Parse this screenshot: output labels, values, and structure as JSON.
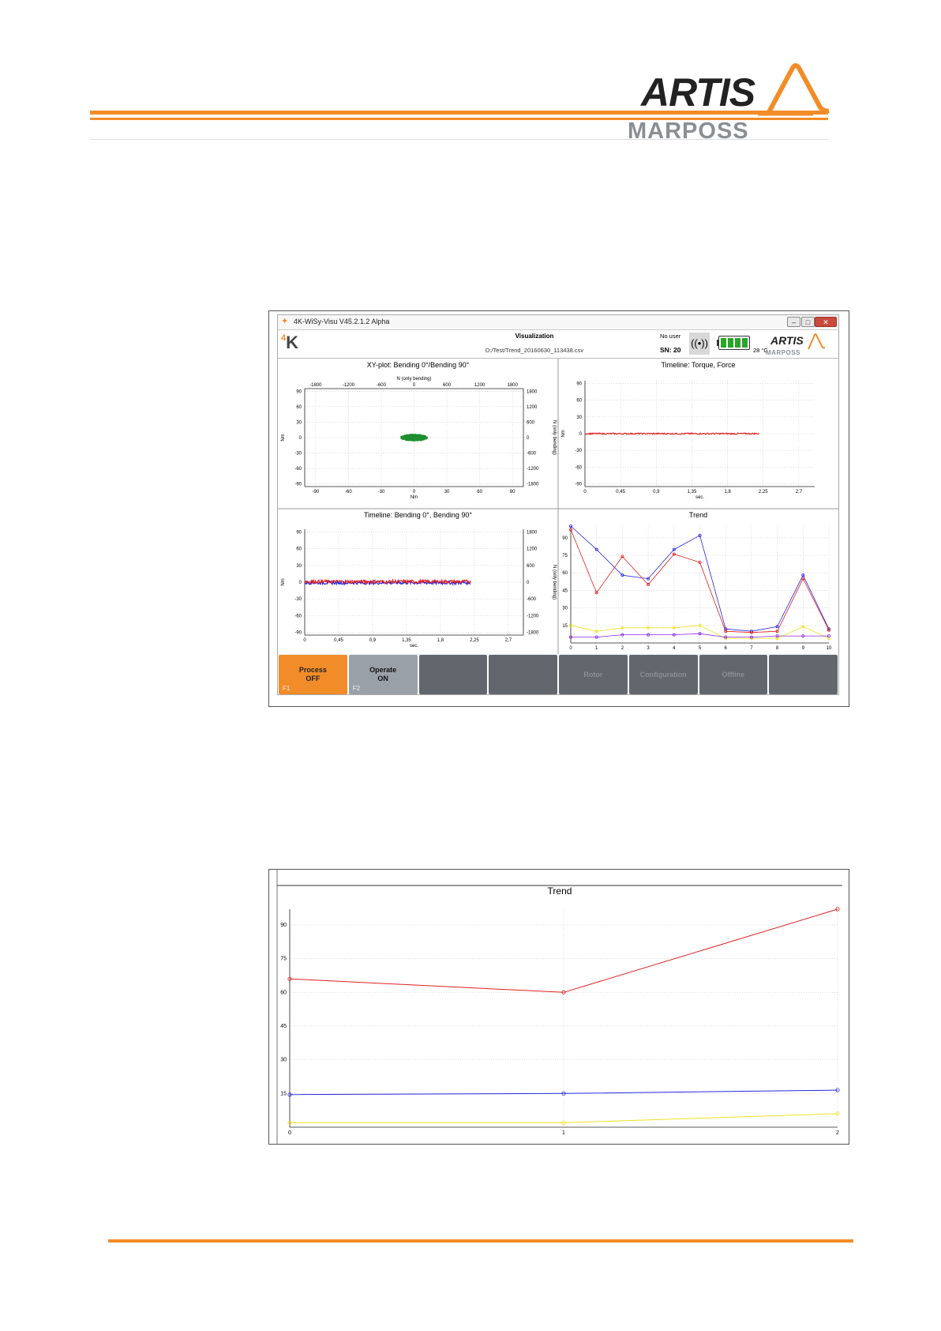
{
  "header": {
    "logo_brand": "ARTIS",
    "logo_sub": "MARPOSS"
  },
  "window": {
    "title": "4K-WiSy-Visu   V45.2.1.2 Alpha",
    "view_title": "Visualization",
    "file_path": "D:/Test/Trend_20160630_113438.csv",
    "user": "No user",
    "sn": "SN: 20",
    "temperature": "28 °C",
    "brand": "ARTIS",
    "brand_sub": "MARPOSS",
    "logo": "4K"
  },
  "function_keys": [
    {
      "label": "Process\nOFF",
      "key": "F1",
      "style": "orange"
    },
    {
      "label": "Operate\nON",
      "key": "F2",
      "style": "light"
    },
    {
      "label": "",
      "key": "",
      "style": "dark"
    },
    {
      "label": "",
      "key": "",
      "style": "dark"
    },
    {
      "label": "Rotor",
      "key": "",
      "style": "dim"
    },
    {
      "label": "Configuration",
      "key": "",
      "style": "dim"
    },
    {
      "label": "Offline",
      "key": "",
      "style": "dim"
    },
    {
      "label": "",
      "key": "",
      "style": "dark"
    }
  ],
  "colors": {
    "accent": "#f28c28",
    "red": "#e02020",
    "blue": "#2828e0",
    "yellow": "#f0e020",
    "purple": "#8a2be2",
    "green": "#1f8f2f"
  },
  "chart_data": [
    {
      "type": "scatter",
      "title": "XY-plot:  Bending 0°/Bending 90°",
      "xlabel": "Nm",
      "ylabel": "Nm",
      "x2label": "N (only bending)",
      "y2label": "N (only bending)",
      "xticks": [
        "-90",
        "-60",
        "-30",
        "0",
        "30",
        "60",
        "90"
      ],
      "x2ticks": [
        "-1800",
        "-1200",
        "-600",
        "0",
        "600",
        "1200",
        "1800"
      ],
      "yticks": [
        "90",
        "60",
        "30",
        "0",
        "-30",
        "-60",
        "-90"
      ],
      "y2ticks": [
        "1800",
        "1200",
        "600",
        "0",
        "-600",
        "-1200",
        "-1800"
      ],
      "xlim": [
        -100,
        100
      ],
      "ylim": [
        -95,
        95
      ],
      "cluster": {
        "center": [
          0,
          0
        ],
        "spread": [
          12,
          6
        ],
        "color": "#1f8f2f"
      }
    },
    {
      "type": "line",
      "title": "Timeline:  Torque, Force",
      "xlabel": "sec.",
      "ylabel": "Nm",
      "xticks": [
        "0",
        "0,45",
        "0,9",
        "1,35",
        "1,8",
        "2,25",
        "2,7"
      ],
      "yticks": [
        "90",
        "60",
        "30",
        "0",
        "-30",
        "-60",
        "-90"
      ],
      "xlim": [
        0,
        2.9
      ],
      "ylim": [
        -95,
        95
      ],
      "series": [
        {
          "color": "#e02020",
          "x_end": 2.2,
          "level": 0,
          "noise": 1.2
        }
      ]
    },
    {
      "type": "line",
      "title": "Timeline:  Bending 0°, Bending 90°",
      "xlabel": "sec.",
      "ylabel": "Nm",
      "y2label": "N (only bending)",
      "xticks": [
        "0",
        "0,45",
        "0,9",
        "1,35",
        "1,8",
        "2,25",
        "2,7"
      ],
      "yticks": [
        "90",
        "60",
        "30",
        "0",
        "-30",
        "-60",
        "-90"
      ],
      "y2ticks": [
        "1800",
        "1200",
        "600",
        "0",
        "-600",
        "-1200",
        "-1800"
      ],
      "xlim": [
        0,
        2.9
      ],
      "ylim": [
        -95,
        95
      ],
      "series": [
        {
          "color": "#2828e0",
          "x_end": 2.2,
          "level": -1,
          "noise": 3
        },
        {
          "color": "#e02020",
          "x_end": 2.2,
          "level": 1,
          "noise": 3
        }
      ]
    },
    {
      "type": "line",
      "title": "Trend",
      "xticks": [
        "0",
        "1",
        "2",
        "3",
        "4",
        "5",
        "6",
        "7",
        "8",
        "9",
        "10"
      ],
      "yticks": [
        "90",
        "75",
        "60",
        "45",
        "30",
        "15"
      ],
      "x": [
        0,
        1,
        2,
        3,
        4,
        5,
        6,
        7,
        8,
        9,
        10
      ],
      "xlim": [
        0,
        10
      ],
      "ylim": [
        0,
        100
      ],
      "series": [
        {
          "color": "#2828e0",
          "values": [
            100,
            80,
            58,
            55,
            80,
            92,
            12,
            10,
            14,
            58,
            12
          ]
        },
        {
          "color": "#e02020",
          "values": [
            97,
            43,
            74,
            50,
            76,
            69,
            10,
            9,
            10,
            55,
            11
          ]
        },
        {
          "color": "#f0e020",
          "values": [
            15,
            10,
            13,
            13,
            13,
            15,
            4,
            4,
            4,
            14,
            4
          ]
        },
        {
          "color": "#8a2be2",
          "values": [
            5,
            5,
            7,
            7,
            7,
            8,
            5,
            5,
            6,
            6,
            6
          ]
        }
      ]
    },
    {
      "type": "line",
      "title": "Trend",
      "xticks": [
        "0",
        "1",
        "2"
      ],
      "yticks": [
        "90",
        "75",
        "60",
        "45",
        "30",
        "15"
      ],
      "x": [
        0,
        1,
        2
      ],
      "xlim": [
        0,
        2
      ],
      "ylim": [
        0,
        97
      ],
      "series": [
        {
          "color": "#e02020",
          "values": [
            66,
            60,
            97
          ]
        },
        {
          "color": "#2828e0",
          "values": [
            14.5,
            15,
            16.5
          ]
        },
        {
          "color": "#f0e020",
          "values": [
            2,
            2,
            6
          ]
        }
      ]
    }
  ]
}
